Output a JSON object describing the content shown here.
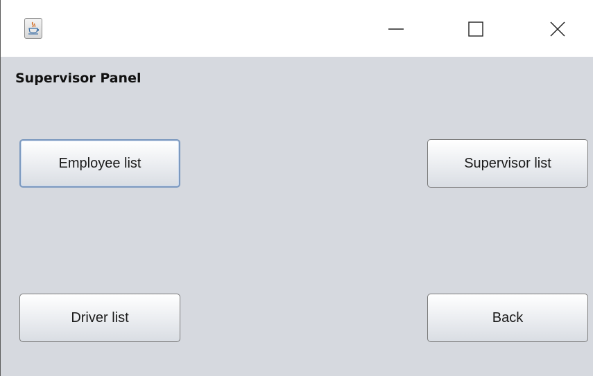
{
  "window": {
    "app_icon": "java-cup-icon",
    "controls": {
      "minimize_icon": "minimize-icon",
      "maximize_icon": "maximize-icon",
      "close_icon": "close-icon"
    }
  },
  "panel": {
    "title": "Supervisor Panel"
  },
  "buttons": {
    "employee_list": "Employee list",
    "supervisor_list": "Supervisor list",
    "driver_list": "Driver list",
    "back": "Back"
  },
  "colors": {
    "content_background": "#d6d9df",
    "focus_border": "#7c99bf"
  }
}
